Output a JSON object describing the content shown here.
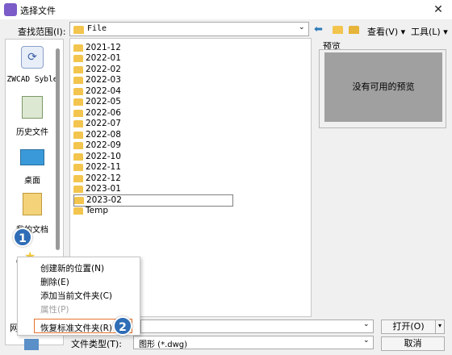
{
  "window": {
    "title": "选择文件"
  },
  "lookin": {
    "label": "查找范围(I):",
    "value": "File",
    "view_label": "查看(V)",
    "tools_label": "工具(L)"
  },
  "sidebar": {
    "places": [
      {
        "label": "ZWCAD Syble",
        "icon": "zwcad-app-icon"
      },
      {
        "label": "历史文件",
        "icon": "history-icon"
      },
      {
        "label": "桌面",
        "icon": "desktop-icon"
      },
      {
        "label": "我的文档",
        "icon": "documents-icon"
      }
    ]
  },
  "files": [
    "2021-12",
    "2022-01",
    "2022-02",
    "2022-03",
    "2022-04",
    "2022-05",
    "2022-06",
    "2022-07",
    "2022-08",
    "2022-09",
    "2022-10",
    "2022-11",
    "2022-12",
    "2023-01",
    "2023-02",
    "Temp"
  ],
  "preview": {
    "label": "预览",
    "empty_text": "没有可用的预览"
  },
  "context_menu": {
    "items": [
      {
        "label": "创建新的位置(N)",
        "enabled": true
      },
      {
        "label": "删除(E)",
        "enabled": true
      },
      {
        "label": "添加当前文件夹(C)",
        "enabled": true
      },
      {
        "label": "属性(P)",
        "enabled": false
      },
      {
        "label": "恢复标准文件夹(R)",
        "enabled": true
      }
    ]
  },
  "badges": {
    "one": "1",
    "two": "2"
  },
  "bottom": {
    "filename_label": "网",
    "filetype_label": "文件类型(T):",
    "filetype_value": "图形 (*.dwg)",
    "open_label": "打开(O)",
    "cancel_label": "取消"
  },
  "colors": {
    "highlight": "#e8732d",
    "badge": "#2f6db6",
    "folder": "#f3c54e"
  }
}
